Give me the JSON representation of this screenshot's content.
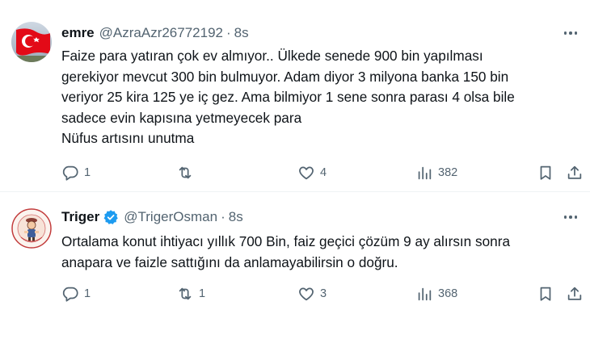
{
  "tweets": [
    {
      "display_name": "emre",
      "handle": "@AzraAzr26772192",
      "separator": "·",
      "time": "8s",
      "verified": false,
      "avatar_icon": "turkish-flag-avatar",
      "lines": [
        "Faize para yatıran çok ev almıyor.. Ülkede senede 900 bin yapılması",
        "gerekiyor mevcut 300 bin bulmuyor. Adam diyor 3 milyona banka 150 bin",
        "veriyor 25 kira 125 ye iç gez. Ama bilmiyor 1 sene sonra parası 4 olsa bile",
        "sadece evin kapısına yetmeyecek para",
        "Nüfus artısını unutma"
      ],
      "replies": "1",
      "retweets": "",
      "likes": "4",
      "views": "382"
    },
    {
      "display_name": "Triger",
      "handle": "@TrigerOsman",
      "separator": "·",
      "time": "8s",
      "verified": true,
      "avatar_icon": "cartoon-character-avatar",
      "lines": [
        "Ortalama konut ihtiyacı yıllık 700 Bin, faiz geçici çözüm 9 ay alırsın sonra",
        "anapara ve faizle sattığını da anlamayabilirsin o doğru."
      ],
      "replies": "1",
      "retweets": "1",
      "likes": "3",
      "views": "368"
    }
  ],
  "colors": {
    "text": "#0f1419",
    "secondary": "#536471",
    "verified_blue": "#1d9bf0",
    "flag_red": "#e30a17",
    "divider": "#eff3f4"
  }
}
